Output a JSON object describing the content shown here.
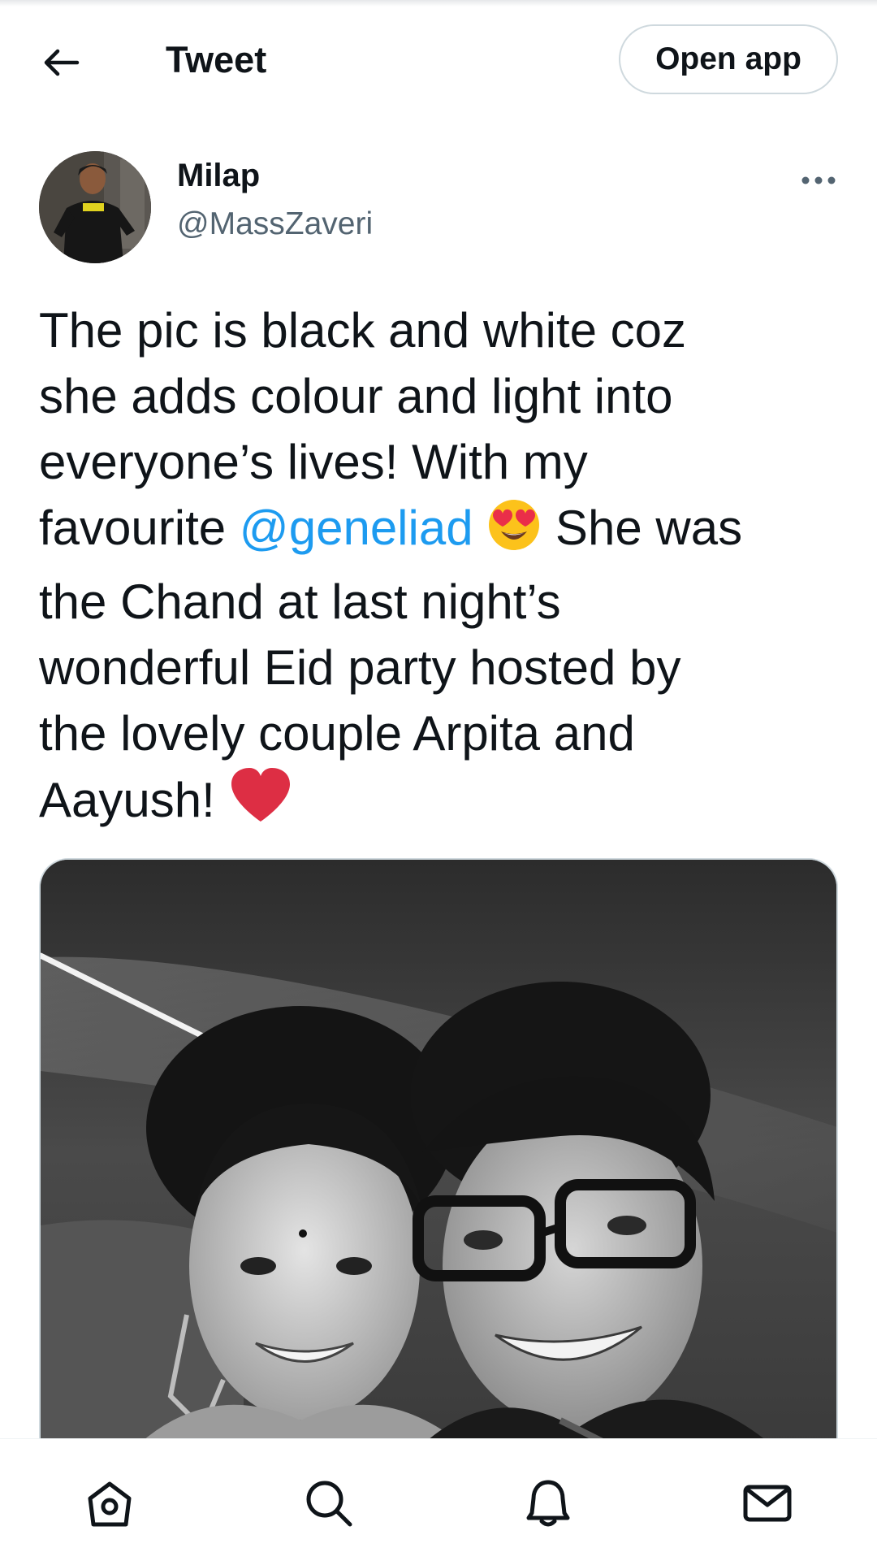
{
  "header": {
    "title": "Tweet",
    "open_app_label": "Open app"
  },
  "author": {
    "name": "Milap",
    "handle": "@MassZaveri"
  },
  "tweet": {
    "lines": [
      "The pic is black and white coz",
      "she adds colour and light into",
      "everyone’s lives! With my"
    ],
    "line4_prefix": "favourite ",
    "mention": "@geneliad",
    "line4_suffix": " She was",
    "lines_after": [
      "the Chand at last night’s",
      "wonderful Eid party hosted by",
      "the lovely couple Arpita and"
    ],
    "last_line": "Aayush! ",
    "emojis": [
      "heart-eyes-emoji",
      "red-heart-emoji"
    ]
  },
  "colors": {
    "accent": "#1d9bf0",
    "text": "#0f1419",
    "secondary": "#536471",
    "border": "#cfd9de"
  },
  "bottom_nav": {
    "items": [
      "home-icon",
      "search-icon",
      "notifications-icon",
      "messages-icon"
    ]
  }
}
